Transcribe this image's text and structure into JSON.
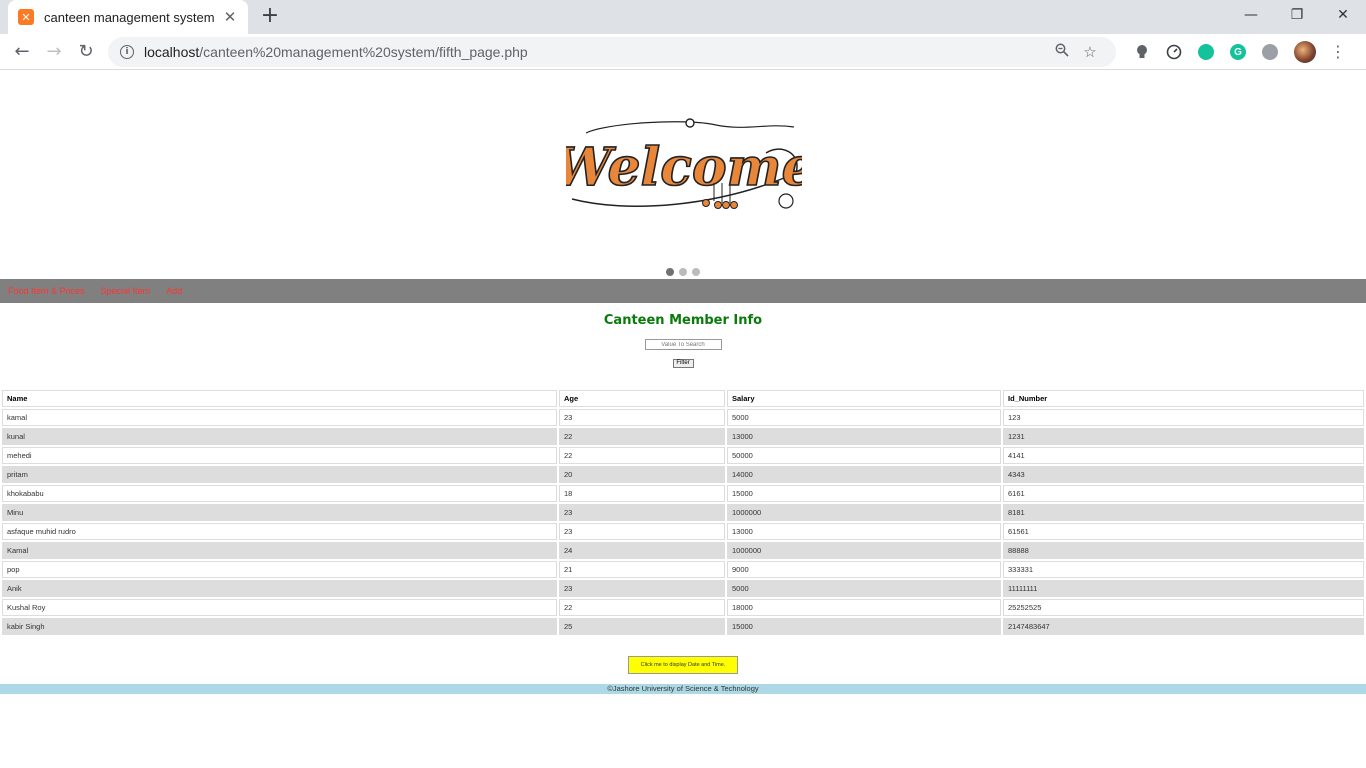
{
  "browser": {
    "tab_title": "canteen management system",
    "url_host": "localhost",
    "url_path": "/canteen%20management%20system/fifth_page.php"
  },
  "banner": {
    "image_text": "Welcome"
  },
  "navbar": {
    "items": [
      "Food Item & Prices",
      "Special Item",
      "Add"
    ]
  },
  "page": {
    "heading": "Canteen Member Info",
    "search_placeholder": "Value To Search",
    "filter_label": "Filter",
    "date_button_label": "Click me to display Date and Time.",
    "footer_text": "©Jashore University of Science & Technology"
  },
  "table": {
    "columns": [
      "Name",
      "Age",
      "Salary",
      "Id_Number"
    ],
    "rows": [
      [
        "kamal",
        "23",
        "5000",
        "123"
      ],
      [
        "kunal",
        "22",
        "13000",
        "1231"
      ],
      [
        "mehedi",
        "22",
        "50000",
        "4141"
      ],
      [
        "pritam",
        "20",
        "14000",
        "4343"
      ],
      [
        "khokababu",
        "18",
        "15000",
        "6161"
      ],
      [
        "Minu",
        "23",
        "1000000",
        "8181"
      ],
      [
        "asfaque muhid rudro",
        "23",
        "13000",
        "61561"
      ],
      [
        "Kamal",
        "24",
        "1000000",
        "88888"
      ],
      [
        "pop",
        "21",
        "9000",
        "333331"
      ],
      [
        "Anik",
        "23",
        "5000",
        "11111111"
      ],
      [
        "Kushal Roy",
        "22",
        "18000",
        "25252525"
      ],
      [
        "kabir Singh",
        "25",
        "15000",
        "2147483647"
      ]
    ]
  },
  "colors": {
    "heading": "#0a7a0a",
    "navbar_bg": "#808080",
    "navbar_link": "#ff3333",
    "footer_bg": "#add8e6",
    "date_button_bg": "#ffff00"
  }
}
